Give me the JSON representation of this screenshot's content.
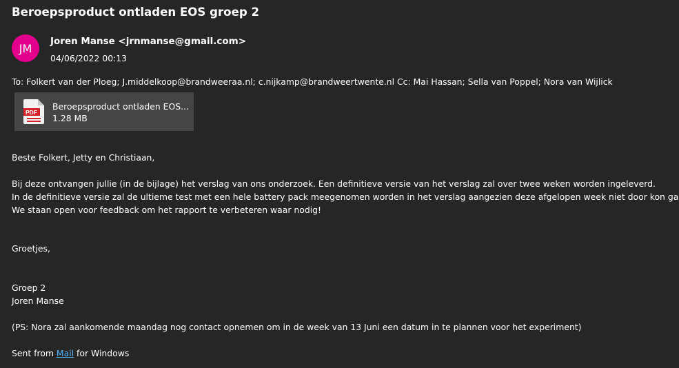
{
  "email": {
    "subject": "Beroepsproduct ontladen EOS groep 2",
    "sender": {
      "initials": "JM",
      "display": "Joren Manse  <jrnmanse@gmail.com>",
      "avatar_color": "#e3008c"
    },
    "date": "04/06/2022 00:13",
    "recipients_line": "To: Folkert van der Ploeg; J.middelkoop@brandweeraa.nl; c.nijkamp@brandweertwente.nl Cc: Mai Hassan; Sella van Poppel; Nora van Wijlick",
    "attachment": {
      "icon": "pdf-file-icon",
      "icon_label": "PDF",
      "name": "Beroepsproduct ontladen EOS...",
      "size": "1.28 MB"
    },
    "body": {
      "greeting": "Beste Folkert, Jetty en Christiaan,",
      "paragraph_1": "Bij deze ontvangen jullie (in de bijlage) het verslag van ons onderzoek. Een definitieve versie van het verslag zal over twee weken worden ingeleverd.",
      "paragraph_2": "In de definitieve versie zal de ultieme test met een hele battery pack meegenomen worden in het verslag aangezien deze afgelopen week niet door kon gaan.",
      "paragraph_3": "We staan open voor feedback om het rapport te verbeteren waar nodig!",
      "closing": "Groetjes,",
      "signature_1": "Groep 2",
      "signature_2": "Joren Manse",
      "ps": "(PS: Nora zal aankomende maandag nog contact opnemen om in de week van 13 Juni een datum in te plannen voor het experiment)",
      "sent_prefix": "Sent from ",
      "sent_link": "Mail",
      "sent_suffix": " for Windows"
    }
  },
  "colors": {
    "background": "#262626",
    "attachment_bg": "#454545",
    "link": "#4fb3ff",
    "pdf_red": "#d4242b"
  }
}
